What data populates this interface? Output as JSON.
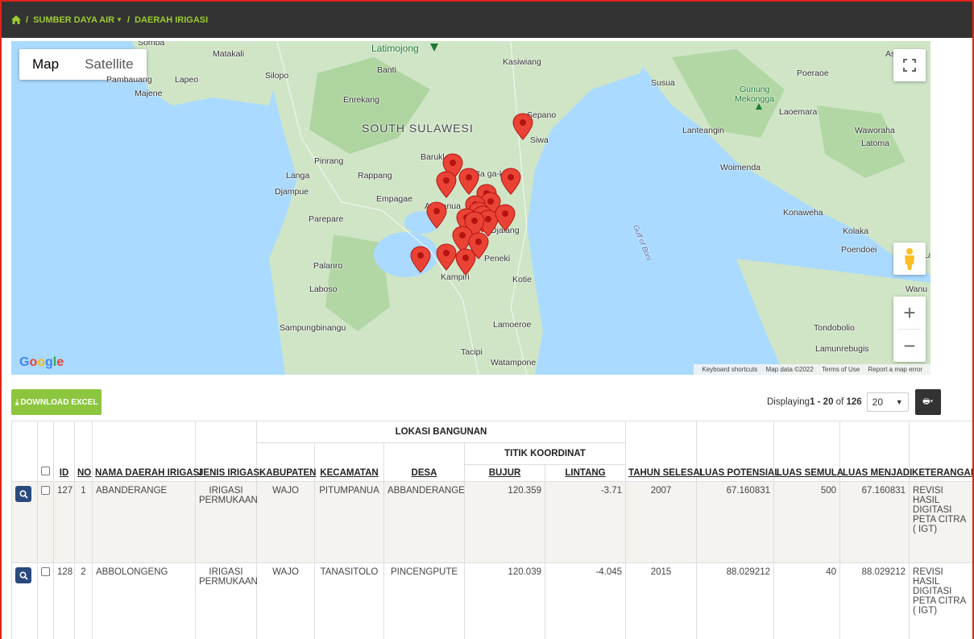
{
  "breadcrumb": {
    "home_icon": "home-icon",
    "section": "SUMBER DAYA AIR",
    "page": "DAERAH IRIGASI"
  },
  "map": {
    "type_map": "Map",
    "type_satellite": "Satellite",
    "google_logo": "Google",
    "attribution": {
      "shortcuts": "Keyboard shortcuts",
      "data": "Map data ©2022",
      "terms": "Terms of Use",
      "report": "Report a map error"
    },
    "labels": {
      "south_sulawesi": "SOUTH SULAWESI",
      "matakali": "Matakali",
      "silopo": "Silopo",
      "pambauang": "Pambauang",
      "lapeo": "Lapeo",
      "majene": "Majene",
      "somba": "Somba",
      "latimojong": "Latimojong",
      "banti": "Banti",
      "kasiwiang": "Kasiwiang",
      "enrekang": "Enrekang",
      "siwa": "Siwa",
      "sengkang": "Sepano",
      "baruk": "Barukl",
      "bajoe": "Ba  ga-kera",
      "pinrang": "Pinrang",
      "langa": "Langa",
      "rappang": "Rappang",
      "djampue": "Djampue",
      "empagae": "Empagae",
      "anabanua": "An   banua",
      "parepare": "Parepare",
      "djalang": "Djalang",
      "palanro": "Palanro",
      "peneki": "Peneki",
      "kampiri": "Kampiri",
      "kotie": "Kotie",
      "laboso": "Laboso",
      "sampungbinangu": "Sampungbinangu",
      "lamoeroe": "Lamoeroe",
      "tacipi": "Tacipi",
      "watampone": "Watampone",
      "susua": "Susua",
      "gunung": "Gunung",
      "mekongga": "Mekongga",
      "poeraoe": "Poeraoe",
      "laoemara": "Laoemara",
      "lanteangin": "Lanteangin",
      "waworaha": "Waworaha",
      "latoma": "Latoma",
      "woimenda": "Woimenda",
      "konaweha": "Konaweha",
      "kolaka": "Kolaka",
      "poendoei": "Poendoei",
      "gulf": "Gulf of Boni",
      "tondobolio": "Tondobolio",
      "lamunrebugis": "Lamunrebugis",
      "wanu": "Wanu",
      "as": "As",
      "la": "La"
    }
  },
  "toolbar": {
    "download_label": "DOWNLOAD EXCEL",
    "displaying_prefix": "Displaying ",
    "range": "1 - 20",
    "of_text": " of ",
    "total": "126",
    "page_size": "20"
  },
  "table": {
    "group_lokasi": "LOKASI BANGUNAN",
    "group_titik": "TITIK KOORDINAT",
    "headers": {
      "id": "ID",
      "no": "NO",
      "nama": "NAMA DAERAH IRIGASI",
      "jenis": "JENIS IRIGASI",
      "kabupaten": "KABUPATEN",
      "kecamatan": "KECAMATAN",
      "desa": "DESA",
      "bujur": "BUJUR",
      "lintang": "LINTANG",
      "tahun": "TAHUN SELESAI",
      "potensial": "LUAS POTENSIAL",
      "semula": "LUAS SEMULA",
      "menjadi": "LUAS MENJADI",
      "keterangan": "KETERANGAN"
    },
    "rows": [
      {
        "id": "127",
        "no": "1",
        "nama": "ABANDERANGE",
        "jenis": "IRIGASI PERMUKAAN",
        "kabupaten": "WAJO",
        "kecamatan": "PITUMPANUA",
        "desa": "ABBANDERANGE",
        "bujur": "120.359",
        "lintang": "-3.71",
        "tahun": "2007",
        "potensial": "67.160831",
        "semula": "500",
        "menjadi": "67.160831",
        "keterangan": "REVISI HASIL DIGITASI PETA CITRA ( IGT)"
      },
      {
        "id": "128",
        "no": "2",
        "nama": "ABBOLONGENG",
        "jenis": "IRIGASI PERMUKAAN",
        "kabupaten": "WAJO",
        "kecamatan": "TANASITOLO",
        "desa": "PINCENGPUTE",
        "bujur": "120.039",
        "lintang": "-4.045",
        "tahun": "2015",
        "potensial": "88.029212",
        "semula": "40",
        "menjadi": "88.029212",
        "keterangan": "REVISI HASIL DIGITASI PETA CITRA ( IGT)"
      }
    ]
  }
}
